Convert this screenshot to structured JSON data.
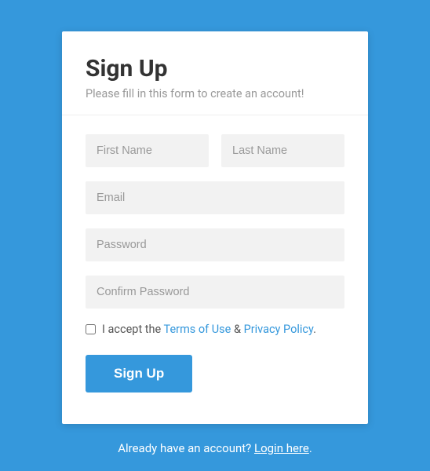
{
  "title": "Sign Up",
  "subtitle": "Please fill in this form to create an account!",
  "fields": {
    "first_name": {
      "placeholder": "First Name",
      "value": ""
    },
    "last_name": {
      "placeholder": "Last Name",
      "value": ""
    },
    "email": {
      "placeholder": "Email",
      "value": ""
    },
    "password": {
      "placeholder": "Password",
      "value": ""
    },
    "confirm_password": {
      "placeholder": "Confirm Password",
      "value": ""
    }
  },
  "terms": {
    "checked": false,
    "prefix": "I accept the ",
    "link1": "Terms of Use",
    "mid": " & ",
    "link2": "Privacy Policy",
    "suffix": "."
  },
  "submit_label": "Sign Up",
  "footer": {
    "text": "Already have an account? ",
    "link": "Login here",
    "suffix": "."
  }
}
